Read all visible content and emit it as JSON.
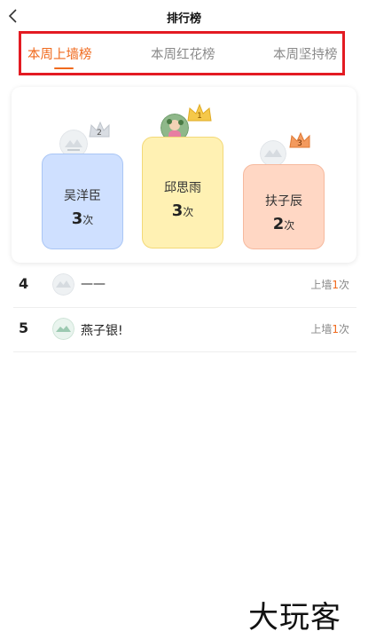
{
  "header": {
    "title": "排行榜"
  },
  "tabs": [
    {
      "label": "本周上墙榜",
      "active": true
    },
    {
      "label": "本周红花榜",
      "active": false
    },
    {
      "label": "本周坚持榜",
      "active": false
    }
  ],
  "podium": [
    {
      "rank": "1",
      "name": "邱思雨",
      "count": "3",
      "unit": "次"
    },
    {
      "rank": "2",
      "name": "吴洋臣",
      "count": "3",
      "unit": "次"
    },
    {
      "rank": "3",
      "name": "扶子辰",
      "count": "2",
      "unit": "次"
    }
  ],
  "list": [
    {
      "rank": "4",
      "name": "——",
      "meta_prefix": "上墙",
      "count": "1",
      "unit": "次"
    },
    {
      "rank": "5",
      "name": "燕子银!",
      "meta_prefix": "上墙",
      "count": "1",
      "unit": "次"
    }
  ],
  "watermark": "大玩客",
  "colors": {
    "accent": "#f06a1d",
    "highlight_box": "#e31b22",
    "gold": "#f5c84a",
    "silver": "#d9dde3",
    "bronze": "#f39a5e"
  }
}
